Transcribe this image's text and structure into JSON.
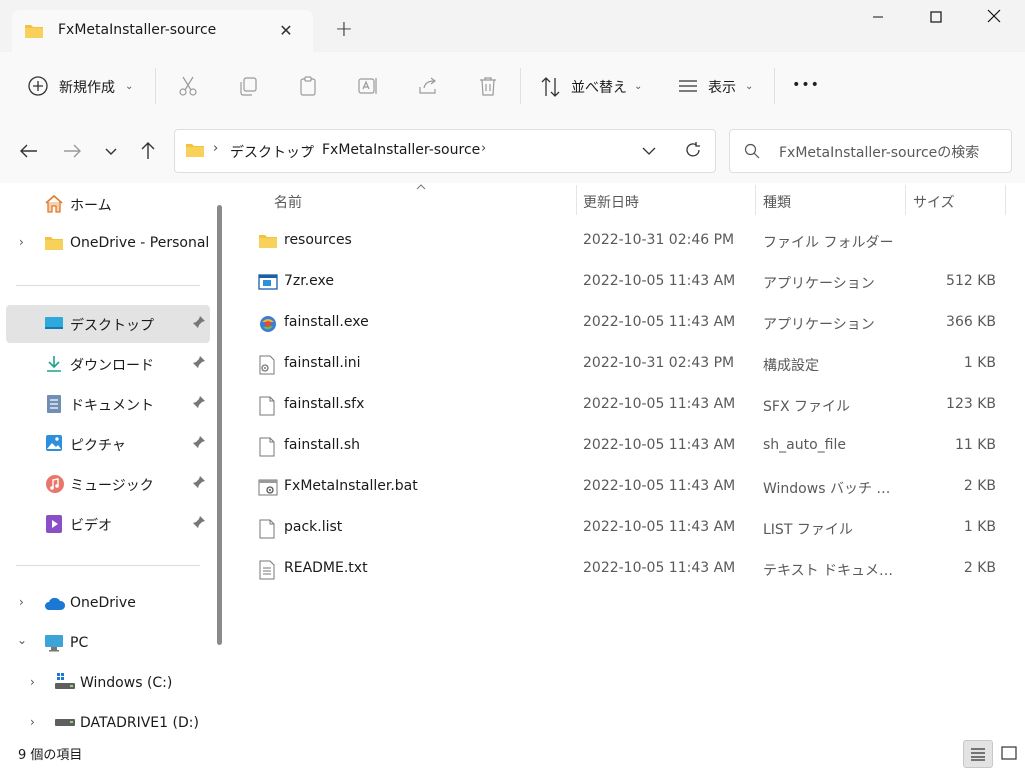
{
  "window": {
    "tab_title": "FxMetaInstaller-source",
    "new_tab": "+",
    "close_tab": "✕"
  },
  "toolbar": {
    "new_label": "新規作成",
    "sort_label": "並べ替え",
    "view_label": "表示",
    "more_label": "•••"
  },
  "address": {
    "crumbs": [
      "デスクトップ",
      "FxMetaInstaller-source"
    ]
  },
  "search": {
    "placeholder": "FxMetaInstaller-sourceの検索"
  },
  "sidebar": {
    "home": "ホーム",
    "onedrive_personal": "OneDrive - Personal",
    "quick": [
      "デスクトップ",
      "ダウンロード",
      "ドキュメント",
      "ピクチャ",
      "ミュージック",
      "ビデオ"
    ],
    "onedrive": "OneDrive",
    "pc": "PC",
    "drive_c": "Windows  (C:)",
    "drive_d": "DATADRIVE1 (D:)"
  },
  "columns": {
    "name": "名前",
    "date": "更新日時",
    "type": "種類",
    "size": "サイズ"
  },
  "files": [
    {
      "name": "resources",
      "date": "2022-10-31 02:46 PM",
      "type": "ファイル フォルダー",
      "size": "",
      "icon": "folder-icon"
    },
    {
      "name": "7zr.exe",
      "date": "2022-10-05 11:43 AM",
      "type": "アプリケーション",
      "size": "512 KB",
      "icon": "exe-icon"
    },
    {
      "name": "fainstall.exe",
      "date": "2022-10-05 11:43 AM",
      "type": "アプリケーション",
      "size": "366 KB",
      "icon": "installer-icon"
    },
    {
      "name": "fainstall.ini",
      "date": "2022-10-31 02:43 PM",
      "type": "構成設定",
      "size": "1 KB",
      "icon": "ini-file-icon"
    },
    {
      "name": "fainstall.sfx",
      "date": "2022-10-05 11:43 AM",
      "type": "SFX ファイル",
      "size": "123 KB",
      "icon": "file-icon"
    },
    {
      "name": "fainstall.sh",
      "date": "2022-10-05 11:43 AM",
      "type": "sh_auto_file",
      "size": "11 KB",
      "icon": "file-icon"
    },
    {
      "name": "FxMetaInstaller.bat",
      "date": "2022-10-05 11:43 AM",
      "type": "Windows バッチ ファイル",
      "size": "2 KB",
      "icon": "batch-file-icon"
    },
    {
      "name": "pack.list",
      "date": "2022-10-05 11:43 AM",
      "type": "LIST ファイル",
      "size": "1 KB",
      "icon": "file-icon"
    },
    {
      "name": "README.txt",
      "date": "2022-10-05 11:43 AM",
      "type": "テキスト ドキュメント",
      "size": "2 KB",
      "icon": "text-file-icon"
    }
  ],
  "status": {
    "count": "9 個の項目"
  },
  "colors": {
    "accent": "#0067c0",
    "folder": "#f3c33f"
  }
}
